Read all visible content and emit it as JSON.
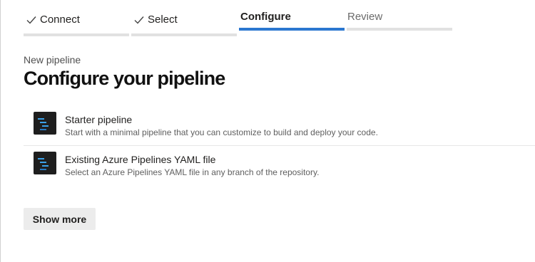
{
  "wizard": {
    "steps": [
      {
        "label": "Connect",
        "state": "done"
      },
      {
        "label": "Select",
        "state": "done"
      },
      {
        "label": "Configure",
        "state": "active"
      },
      {
        "label": "Review",
        "state": "pending"
      }
    ]
  },
  "header": {
    "subtitle": "New pipeline",
    "title": "Configure your pipeline"
  },
  "options": [
    {
      "title": "Starter pipeline",
      "description": "Start with a minimal pipeline that you can customize to build and deploy your code.",
      "icon": "pipeline-icon"
    },
    {
      "title": "Existing Azure Pipelines YAML file",
      "description": "Select an Azure Pipelines YAML file in any branch of the repository.",
      "icon": "pipeline-icon"
    }
  ],
  "actions": {
    "show_more_label": "Show more"
  },
  "colors": {
    "accent": "#2b77d0",
    "icon_background": "#1e1e1e",
    "icon_lines": "#3aa0e8"
  }
}
